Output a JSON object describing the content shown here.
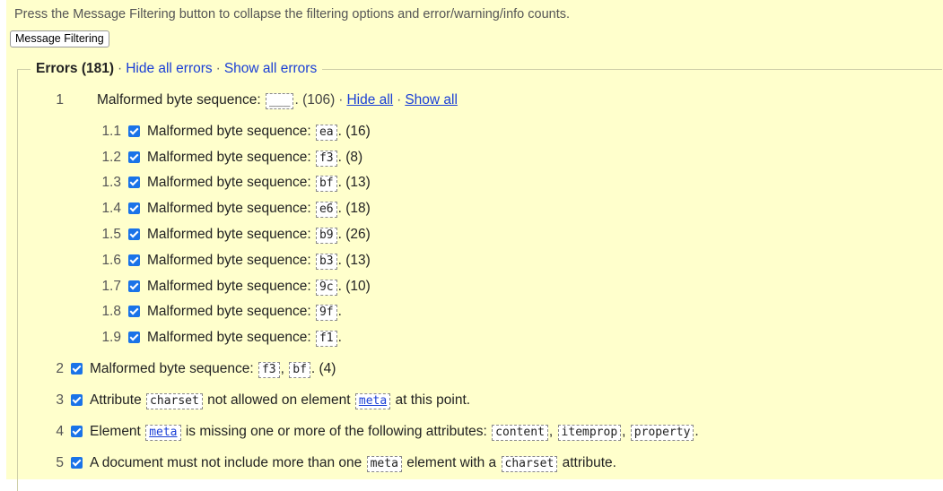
{
  "intro_text": "Press the Message Filtering button to collapse the filtering options and error/warning/info counts.",
  "filter_button_label": "Message Filtering",
  "errors_group": {
    "title": "Errors (181)",
    "hide_all": "Hide all errors",
    "show_all": "Show all errors",
    "separator": "·"
  },
  "group1": {
    "num": "1",
    "text": "Malformed byte sequence:",
    "code": "___",
    "count": ". (106)",
    "hide_all": "Hide all",
    "show_all": "Show all",
    "subitems": [
      {
        "num": "1.1",
        "text": "Malformed byte sequence:",
        "code": "ea",
        "count": ". (16)"
      },
      {
        "num": "1.2",
        "text": "Malformed byte sequence:",
        "code": "f3",
        "count": ". (8)"
      },
      {
        "num": "1.3",
        "text": "Malformed byte sequence:",
        "code": "bf",
        "count": ". (13)"
      },
      {
        "num": "1.4",
        "text": "Malformed byte sequence:",
        "code": "e6",
        "count": ". (18)"
      },
      {
        "num": "1.5",
        "text": "Malformed byte sequence:",
        "code": "b9",
        "count": ". (26)"
      },
      {
        "num": "1.6",
        "text": "Malformed byte sequence:",
        "code": "b3",
        "count": ". (13)"
      },
      {
        "num": "1.7",
        "text": "Malformed byte sequence:",
        "code": "9c",
        "count": ". (10)"
      },
      {
        "num": "1.8",
        "text": "Malformed byte sequence:",
        "code": "9f",
        "count": "."
      },
      {
        "num": "1.9",
        "text": "Malformed byte sequence:",
        "code": "f1",
        "count": "."
      }
    ]
  },
  "items": {
    "i2": {
      "num": "2",
      "t1": "Malformed byte sequence:",
      "c1": "f3",
      "s1": ",",
      "c2": "bf",
      "t2": ". (4)"
    },
    "i3": {
      "num": "3",
      "t1": "Attribute",
      "c1": "charset",
      "t2": "not allowed on element",
      "c2": "meta",
      "t3": "at this point."
    },
    "i4": {
      "num": "4",
      "t1": "Element",
      "c1": "meta",
      "t2": "is missing one or more of the following attributes:",
      "c2": "content",
      "s1": ",",
      "c3": "itemprop",
      "s2": ",",
      "c4": "property",
      "t3": "."
    },
    "i5": {
      "num": "5",
      "t1": "A document must not include more than one",
      "c1": "meta",
      "t2": "element with a",
      "c2": "charset",
      "t3": "attribute."
    }
  },
  "colors": {
    "panel_bg": "#ffffcc",
    "link": "#1a3fd6",
    "checkbox": "#1a73e8"
  }
}
